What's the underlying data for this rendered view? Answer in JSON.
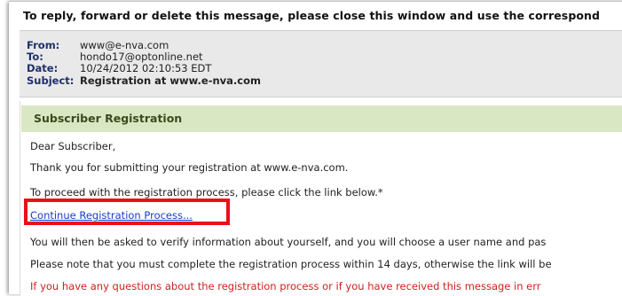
{
  "notice": "To reply, forward or delete this message, please close this window and use the correspond",
  "header": {
    "from_label": "From:",
    "from": "www@e-nva.com",
    "to_label": "To:",
    "to": "hondo17@optonline.net",
    "date_label": "Date:",
    "date": "10/24/2012 02:10:53 EDT",
    "subject_label": "Subject:",
    "subject": "Registration at www.e-nva.com"
  },
  "body": {
    "section_title": "Subscriber Registration",
    "greeting": "Dear Subscriber,",
    "thanks": "Thank you for submitting your registration at www.e-nva.com.",
    "proceed": "To proceed with the registration process, please click the link below.*",
    "link_label": "Continue Registration Process...",
    "verify": "You will then be asked to verify information about yourself, and you will choose a user name and pas",
    "deadline": "Please note that you must complete the registration process within 14 days, otherwise the link will be",
    "questions": "If you have any questions about the registration process or if you have received this message in err"
  },
  "colors": {
    "section_bg": "#d9e8c2",
    "link": "#1a3cc8",
    "highlight_border": "#e8101b",
    "warning_text": "#d02020"
  }
}
